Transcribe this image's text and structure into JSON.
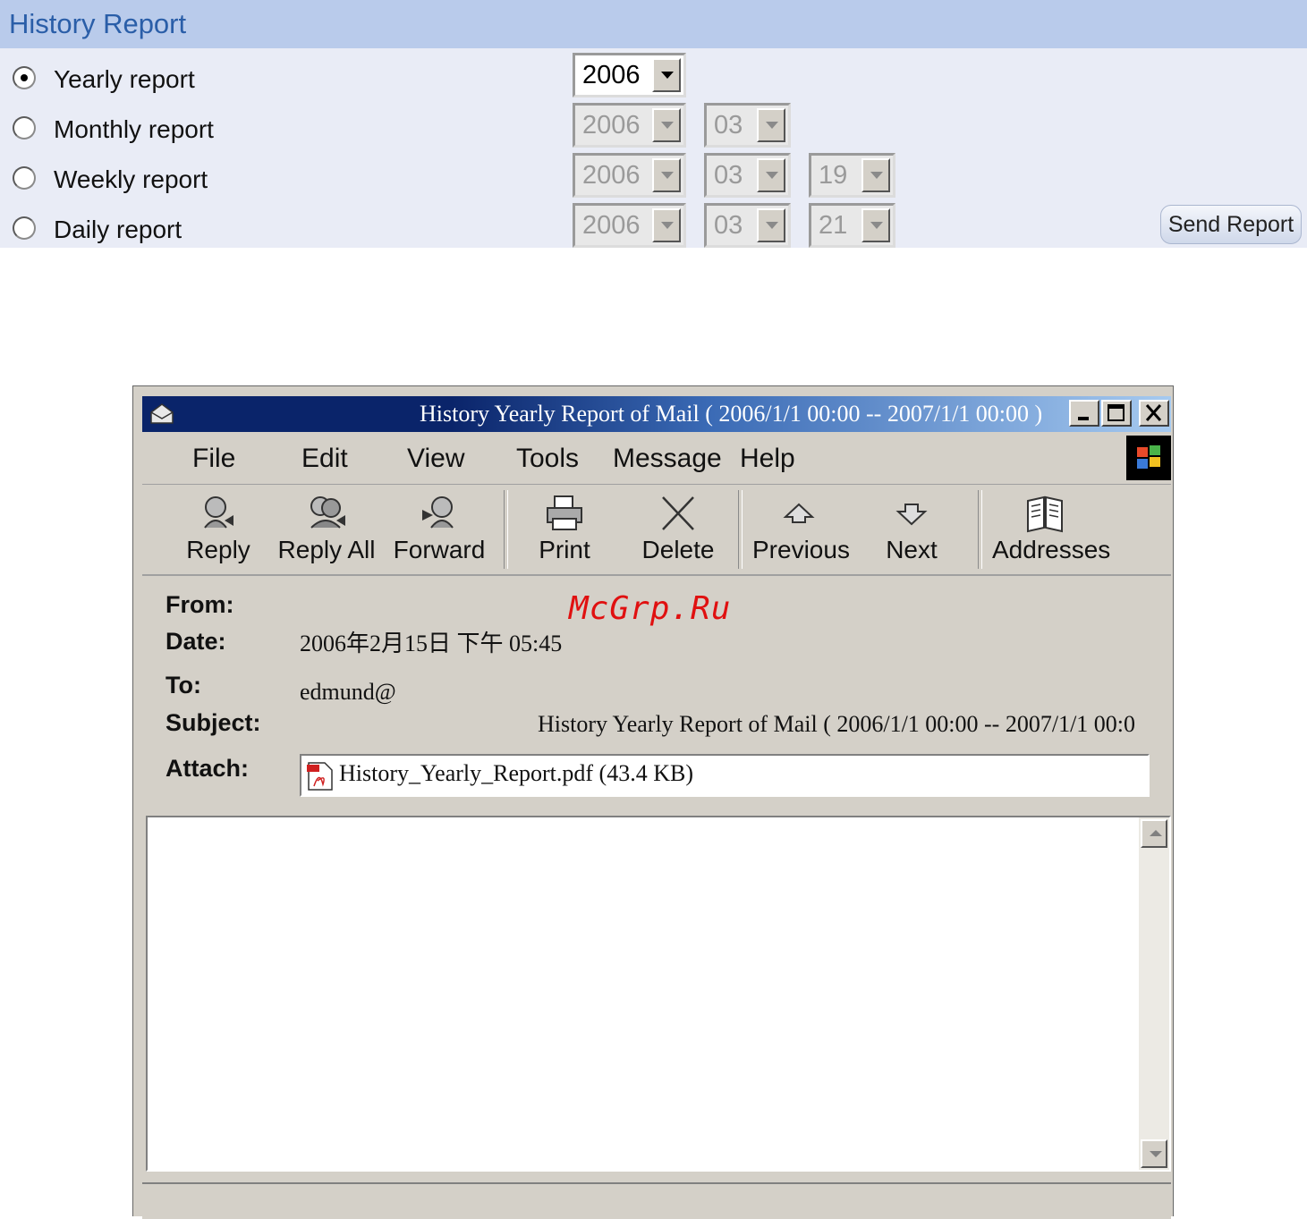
{
  "history_report": {
    "title": "History Report",
    "options": [
      {
        "label": "Yearly report",
        "checked": true
      },
      {
        "label": "Monthly report",
        "checked": false
      },
      {
        "label": "Weekly report",
        "checked": false
      },
      {
        "label": "Daily report",
        "checked": false
      }
    ],
    "yearly": {
      "year": "2006"
    },
    "monthly": {
      "year": "2006",
      "month": "03"
    },
    "weekly": {
      "year": "2006",
      "month": "03",
      "day": "19"
    },
    "daily": {
      "year": "2006",
      "month": "03",
      "day": "21"
    },
    "send_button": "Send Report"
  },
  "mail_window": {
    "title": "History Yearly Report of Mail ( 2006/1/1 00:00 -- 2007/1/1 00:00 )",
    "menu": [
      "File",
      "Edit",
      "View",
      "Tools",
      "Message",
      "Help"
    ],
    "toolbar": {
      "reply": "Reply",
      "reply_all": "Reply All",
      "forward": "Forward",
      "print": "Print",
      "delete": "Delete",
      "previous": "Previous",
      "next": "Next",
      "addresses": "Addresses"
    },
    "headers": {
      "from_label": "From:",
      "date_label": "Date:",
      "to_label": "To:",
      "subject_label": "Subject:",
      "attach_label": "Attach:",
      "date_value": "2006年2月15日 下午 05:45",
      "to_value": "edmund@",
      "subject_value": "History Yearly Report of Mail ( 2006/1/1 00:00 -- 2007/1/1 00:0",
      "attachment": "History_Yearly_Report.pdf (43.4 KB)"
    }
  },
  "watermark": "McGrp.Ru",
  "colors": {
    "header_bg": "#b9cbeb",
    "title_blue": "#2a5ea8",
    "panel_bg": "#e9ecf6",
    "window_gray": "#d4d0c8",
    "titlebar_dark": "#0a246a",
    "watermark_red": "#e01010"
  }
}
